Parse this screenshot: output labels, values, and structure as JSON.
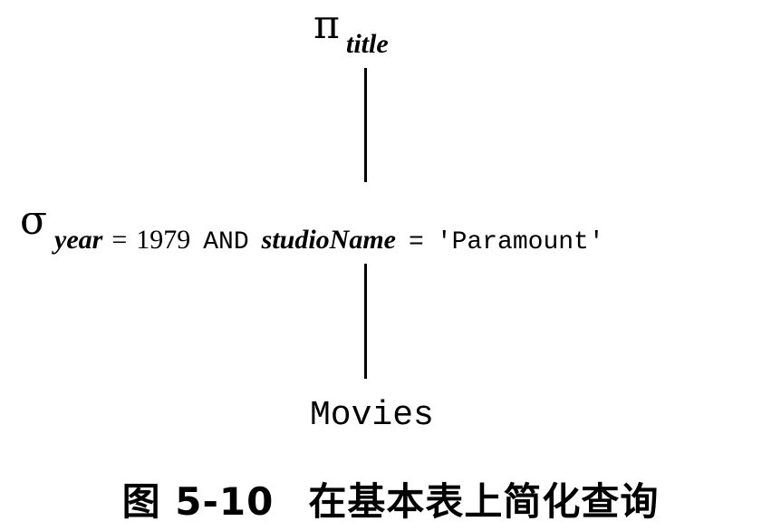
{
  "diagram": {
    "projection": {
      "operator": "π",
      "attribute": "title"
    },
    "selection": {
      "operator": "σ",
      "condition": {
        "attr1": "year",
        "op1": "=",
        "value1": "1979",
        "connector": "AND",
        "attr2": "studioName",
        "op2": "=",
        "value2": "'Paramount'"
      }
    },
    "relation": "Movies"
  },
  "caption": {
    "label": "图 5-10",
    "text": "在基本表上简化查询"
  }
}
